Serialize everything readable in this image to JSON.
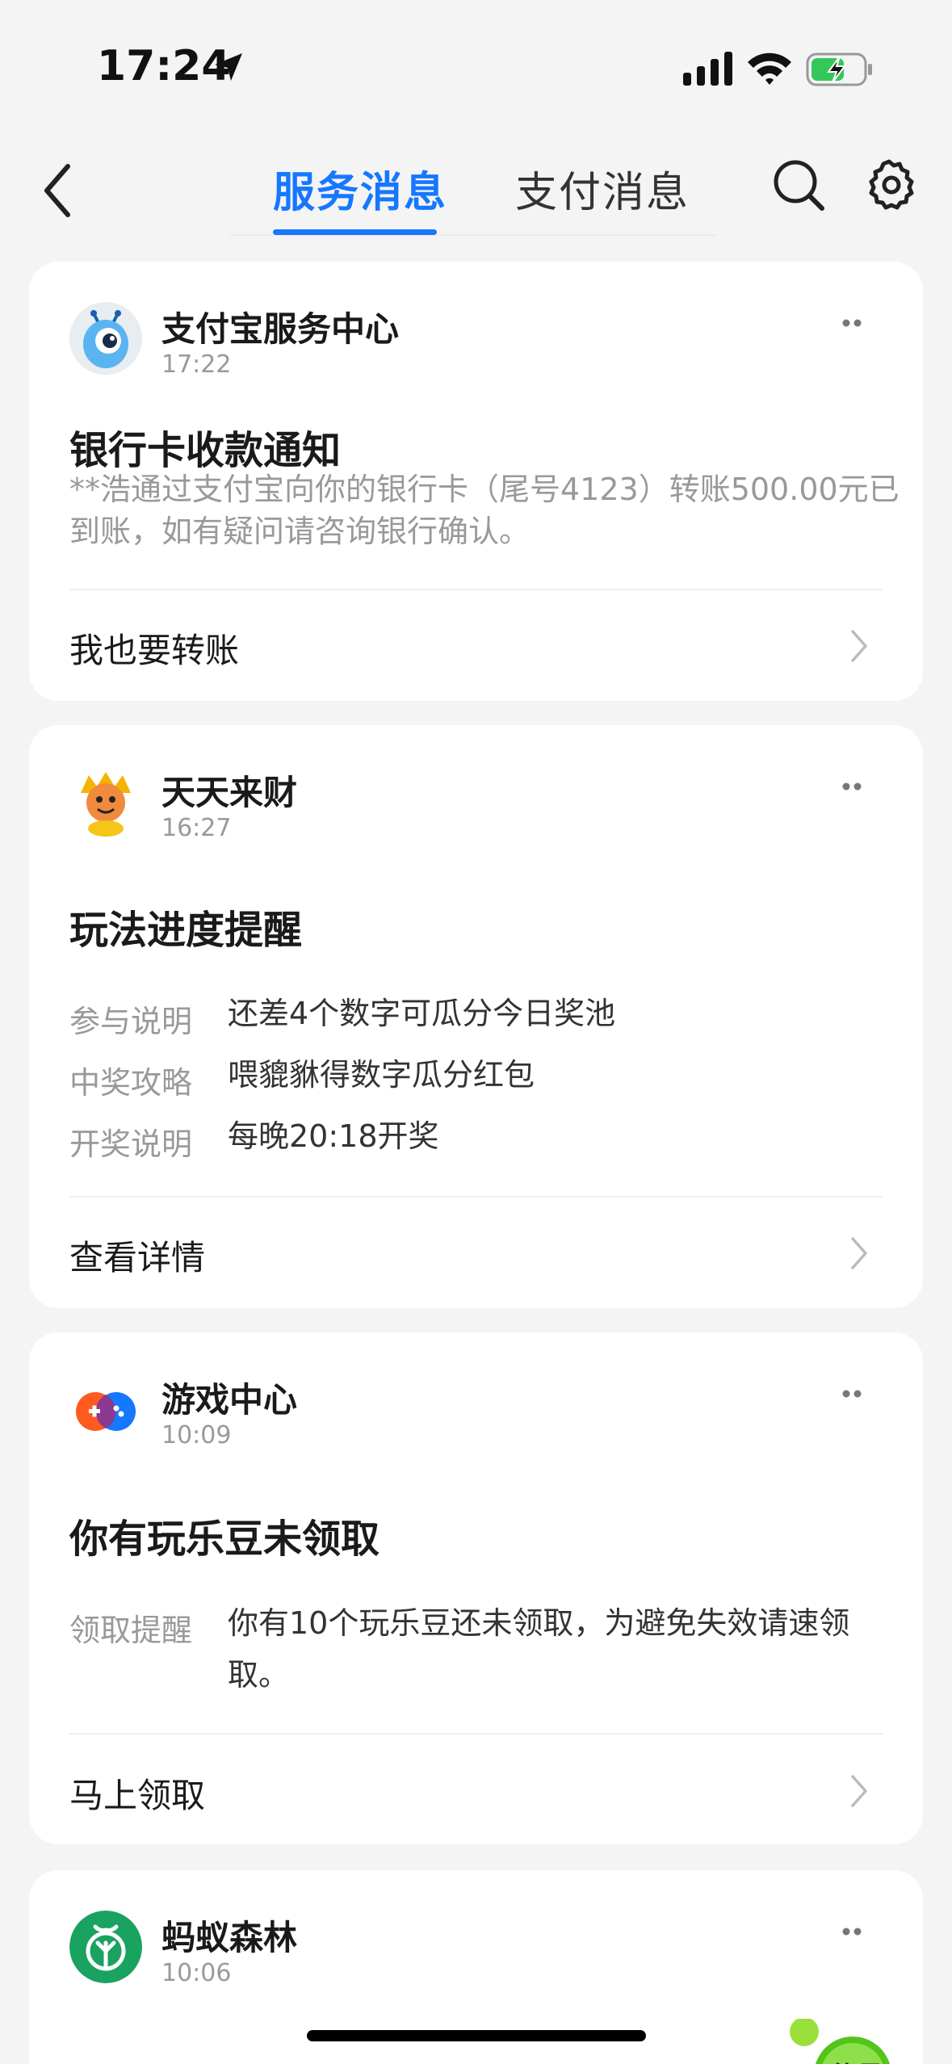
{
  "status_bar": {
    "time": "17:24"
  },
  "nav": {
    "tabs": [
      {
        "label": "服务消息",
        "active": true
      },
      {
        "label": "支付消息",
        "active": false
      }
    ]
  },
  "cards": [
    {
      "sender": "支付宝服务中心",
      "time": "17:22",
      "title": "银行卡收款通知",
      "body": "**浩通过支付宝向你的银行卡（尾号4123）转账500.00元已到账，如有疑问请咨询银行确认。",
      "action": "我也要转账"
    },
    {
      "sender": "天天来财",
      "time": "16:27",
      "title": "玩法进度提醒",
      "rows": [
        {
          "label": "参与说明",
          "value": "还差4个数字可瓜分今日奖池"
        },
        {
          "label": "中奖攻略",
          "value": "喂貔貅得数字瓜分红包"
        },
        {
          "label": "开奖说明",
          "value": "每晚20:18开奖"
        }
      ],
      "action": "查看详情"
    },
    {
      "sender": "游戏中心",
      "time": "10:09",
      "title": "你有玩乐豆未领取",
      "rows": [
        {
          "label": "领取提醒",
          "value": "你有10个玩乐豆还未领取，为避免失效请速领取。"
        }
      ],
      "action": "马上领取"
    },
    {
      "sender": "蚂蚁森林",
      "time": "10:06",
      "badge": "能量"
    }
  ],
  "colors": {
    "accent": "#1677ff",
    "background": "#f4f4f4",
    "card": "#ffffff",
    "secondary_text": "#999999"
  },
  "icons": [
    "location-arrow-icon",
    "signal-icon",
    "wifi-icon",
    "battery-charging-icon",
    "back-icon",
    "search-icon",
    "gear-icon",
    "more-icon",
    "chevron-right-icon"
  ]
}
